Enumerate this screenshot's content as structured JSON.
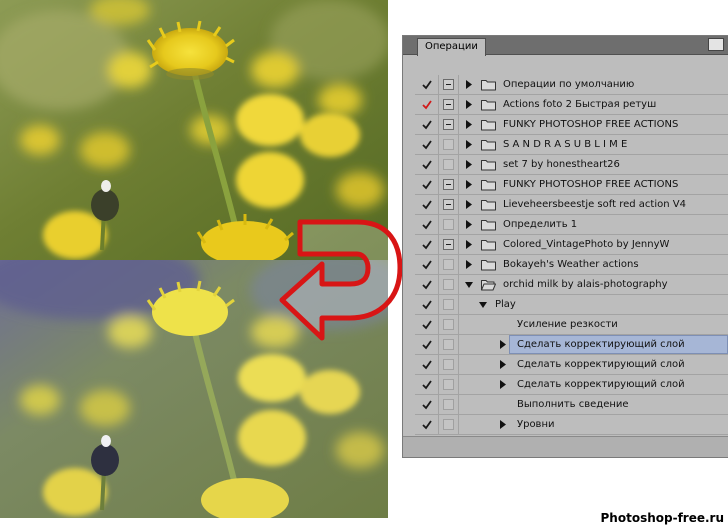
{
  "panel": {
    "tab_label": "Операции",
    "accent_check_red": "#d11a1a",
    "accent_check_dark": "#1a1a1a",
    "selection_color": "#a6b6d6",
    "rows": [
      {
        "label": "Операции по умолчанию",
        "check": "dark",
        "dialog": "filled",
        "expander": "closed",
        "folder": "closed",
        "level": 0
      },
      {
        "label": "Actions foto 2  Быстрая ретуш",
        "check": "red",
        "dialog": "filled",
        "expander": "closed",
        "folder": "closed",
        "level": 0
      },
      {
        "label": "FUNKY PHOTOSHOP FREE ACTIONS",
        "check": "dark",
        "dialog": "filled",
        "expander": "closed",
        "folder": "closed",
        "level": 0
      },
      {
        "label": "S A N D R A S U B L I M E",
        "check": "dark",
        "dialog": "empty",
        "expander": "closed",
        "folder": "closed",
        "level": 0
      },
      {
        "label": "set 7 by honestheart26",
        "check": "dark",
        "dialog": "empty",
        "expander": "closed",
        "folder": "closed",
        "level": 0
      },
      {
        "label": "FUNKY PHOTOSHOP FREE ACTIONS",
        "check": "dark",
        "dialog": "filled",
        "expander": "closed",
        "folder": "closed",
        "level": 0
      },
      {
        "label": "Lieveheersbeestje soft red action V4",
        "check": "dark",
        "dialog": "filled",
        "expander": "closed",
        "folder": "closed",
        "level": 0
      },
      {
        "label": "Определить 1",
        "check": "dark",
        "dialog": "empty",
        "expander": "closed",
        "folder": "closed",
        "level": 0
      },
      {
        "label": "Colored_VintagePhoto by JennyW",
        "check": "dark",
        "dialog": "filled",
        "expander": "closed",
        "folder": "closed",
        "level": 0
      },
      {
        "label": "Bokayeh's Weather actions",
        "check": "dark",
        "dialog": "empty",
        "expander": "closed",
        "folder": "closed",
        "level": 0
      },
      {
        "label": "orchid milk by alais-photography",
        "check": "dark",
        "dialog": "empty",
        "expander": "open",
        "folder": "open",
        "level": 0
      },
      {
        "label": "Play",
        "check": "dark",
        "dialog": "empty",
        "expander": "open",
        "folder": "none",
        "level": 1
      },
      {
        "label": "Усиление резкости",
        "check": "dark",
        "dialog": "empty",
        "expander": "none",
        "folder": "none",
        "level": 2
      },
      {
        "label": "Сделать корректирующий слой",
        "check": "dark",
        "dialog": "empty",
        "expander": "closed",
        "folder": "none",
        "level": 2,
        "selected": true
      },
      {
        "label": "Сделать корректирующий слой",
        "check": "dark",
        "dialog": "empty",
        "expander": "closed",
        "folder": "none",
        "level": 2
      },
      {
        "label": "Сделать корректирующий слой",
        "check": "dark",
        "dialog": "empty",
        "expander": "closed",
        "folder": "none",
        "level": 2
      },
      {
        "label": "Выполнить сведение",
        "check": "dark",
        "dialog": "empty",
        "expander": "none",
        "folder": "none",
        "level": 2
      },
      {
        "label": "Уровни",
        "check": "dark",
        "dialog": "empty",
        "expander": "closed",
        "folder": "none",
        "level": 2
      }
    ]
  },
  "watermark": "Photoshop-free.ru"
}
